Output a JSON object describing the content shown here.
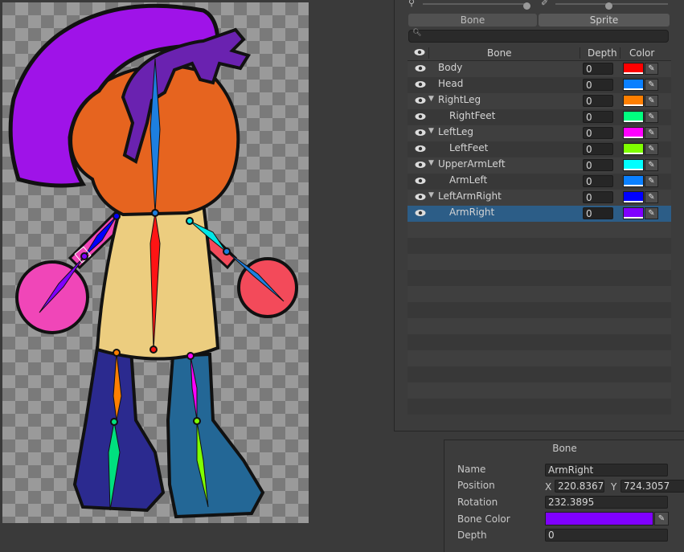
{
  "toolbar": {
    "left_icon": "bone-icon",
    "right_icon": "paint-brush-icon",
    "tabs": [
      {
        "label": "Bone"
      },
      {
        "label": "Sprite"
      }
    ],
    "search_placeholder": ""
  },
  "bone_table": {
    "headers": {
      "visibility": "👁",
      "bone": "Bone",
      "depth": "Depth",
      "color": "Color"
    },
    "rows": [
      {
        "name": "Body",
        "indent": 0,
        "foldout": false,
        "depth": "0",
        "color": "#ff0000",
        "selected": false
      },
      {
        "name": "Head",
        "indent": 0,
        "foldout": false,
        "depth": "0",
        "color": "#0a80ff",
        "selected": false
      },
      {
        "name": "RightLeg",
        "indent": 0,
        "foldout": true,
        "depth": "0",
        "color": "#ff7f00",
        "selected": false
      },
      {
        "name": "RightFeet",
        "indent": 1,
        "foldout": false,
        "depth": "0",
        "color": "#00ff7f",
        "selected": false
      },
      {
        "name": "LeftLeg",
        "indent": 0,
        "foldout": true,
        "depth": "0",
        "color": "#ff00ff",
        "selected": false
      },
      {
        "name": "LeftFeet",
        "indent": 1,
        "foldout": false,
        "depth": "0",
        "color": "#7fff00",
        "selected": false
      },
      {
        "name": "UpperArmLeft",
        "indent": 0,
        "foldout": true,
        "depth": "0",
        "color": "#00ffff",
        "selected": false
      },
      {
        "name": "ArmLeft",
        "indent": 1,
        "foldout": false,
        "depth": "0",
        "color": "#0a80ff",
        "selected": false
      },
      {
        "name": "LeftArmRight",
        "indent": 0,
        "foldout": true,
        "depth": "0",
        "color": "#0000ff",
        "selected": false
      },
      {
        "name": "ArmRight",
        "indent": 1,
        "foldout": false,
        "depth": "0",
        "color": "#7f00ff",
        "selected": true
      }
    ]
  },
  "inspector": {
    "title": "Bone",
    "name_label": "Name",
    "name_value": "ArmRight",
    "position_label": "Position",
    "x_label": "X",
    "x_value": "220.8367",
    "y_label": "Y",
    "y_value": "724.3057",
    "rotation_label": "Rotation",
    "rotation_value": "232.3895",
    "color_label": "Bone Color",
    "color_value": "#7f00ff",
    "depth_label": "Depth",
    "depth_value": "0"
  }
}
